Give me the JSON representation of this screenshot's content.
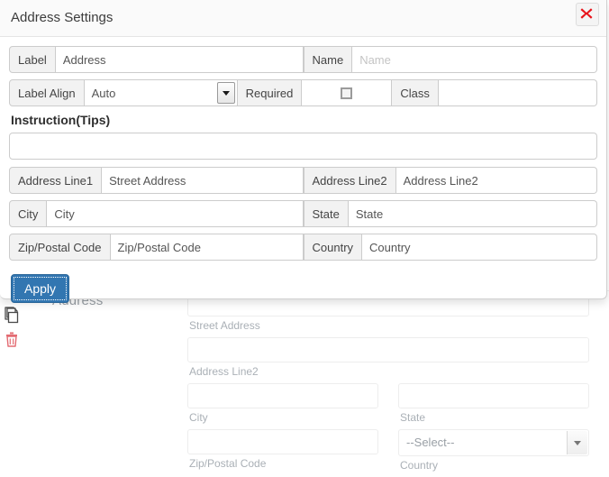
{
  "modal": {
    "title": "Address Settings",
    "close_icon": "close-icon",
    "rows": {
      "label": {
        "addon": "Label",
        "value": "Address",
        "placeholder": "Label"
      },
      "name": {
        "addon": "Name",
        "value": "",
        "placeholder": "Name"
      },
      "label_align": {
        "addon": "Label Align",
        "value": "Auto",
        "options": [
          "Auto"
        ]
      },
      "required": {
        "addon": "Required",
        "checked": false
      },
      "class": {
        "addon": "Class",
        "value": "",
        "placeholder": ""
      },
      "address_line1": {
        "addon": "Address Line1",
        "value": "Street Address"
      },
      "address_line2": {
        "addon": "Address Line2",
        "value": "Address Line2"
      },
      "city": {
        "addon": "City",
        "value": "City"
      },
      "state": {
        "addon": "State",
        "value": "State"
      },
      "zip": {
        "addon": "Zip/Postal Code",
        "value": "Zip/Postal Code"
      },
      "country": {
        "addon": "Country",
        "value": "Country"
      }
    },
    "instruction": {
      "label": "Instruction(Tips)",
      "value": "",
      "placeholder": ""
    },
    "apply_label": "Apply",
    "accent_color": "#3276b1",
    "close_color": "#e8131a"
  },
  "background": {
    "field_title": "Address",
    "copy_icon": "copy-icon",
    "delete_icon": "trash-icon",
    "captions": {
      "street_address": "Street Address",
      "address_line2": "Address Line2",
      "city": "City",
      "state": "State",
      "zip": "Zip/Postal Code",
      "country": "Country"
    },
    "country_select_value": "--Select--"
  }
}
